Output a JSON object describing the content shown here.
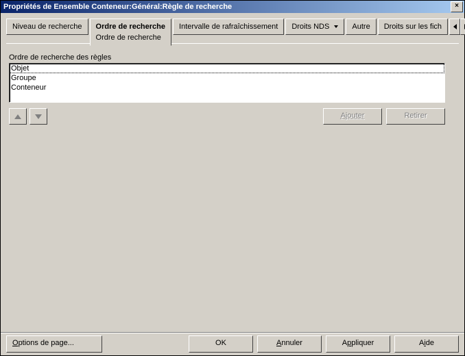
{
  "window": {
    "title": "Propriétés de Ensemble Conteneur:Général:Règle de recherche",
    "close_glyph": "×"
  },
  "tabs": {
    "t0": "Niveau de recherche",
    "t1": "Ordre de recherche",
    "t1_sub": "Ordre de recherche",
    "t2": "Intervalle de rafraîchissement",
    "t3": "Droits NDS",
    "t4": "Autre",
    "t5": "Droits sur les fich"
  },
  "section": {
    "label": "Ordre de recherche des règles",
    "items": [
      "Objet",
      "Groupe",
      "Conteneur"
    ]
  },
  "buttons": {
    "add": "Ajouter",
    "remove": "Retirer",
    "page_options": "Options de page...",
    "ok": "OK",
    "cancel": "Annuler",
    "apply": "Appliquer",
    "help": "Aide"
  }
}
